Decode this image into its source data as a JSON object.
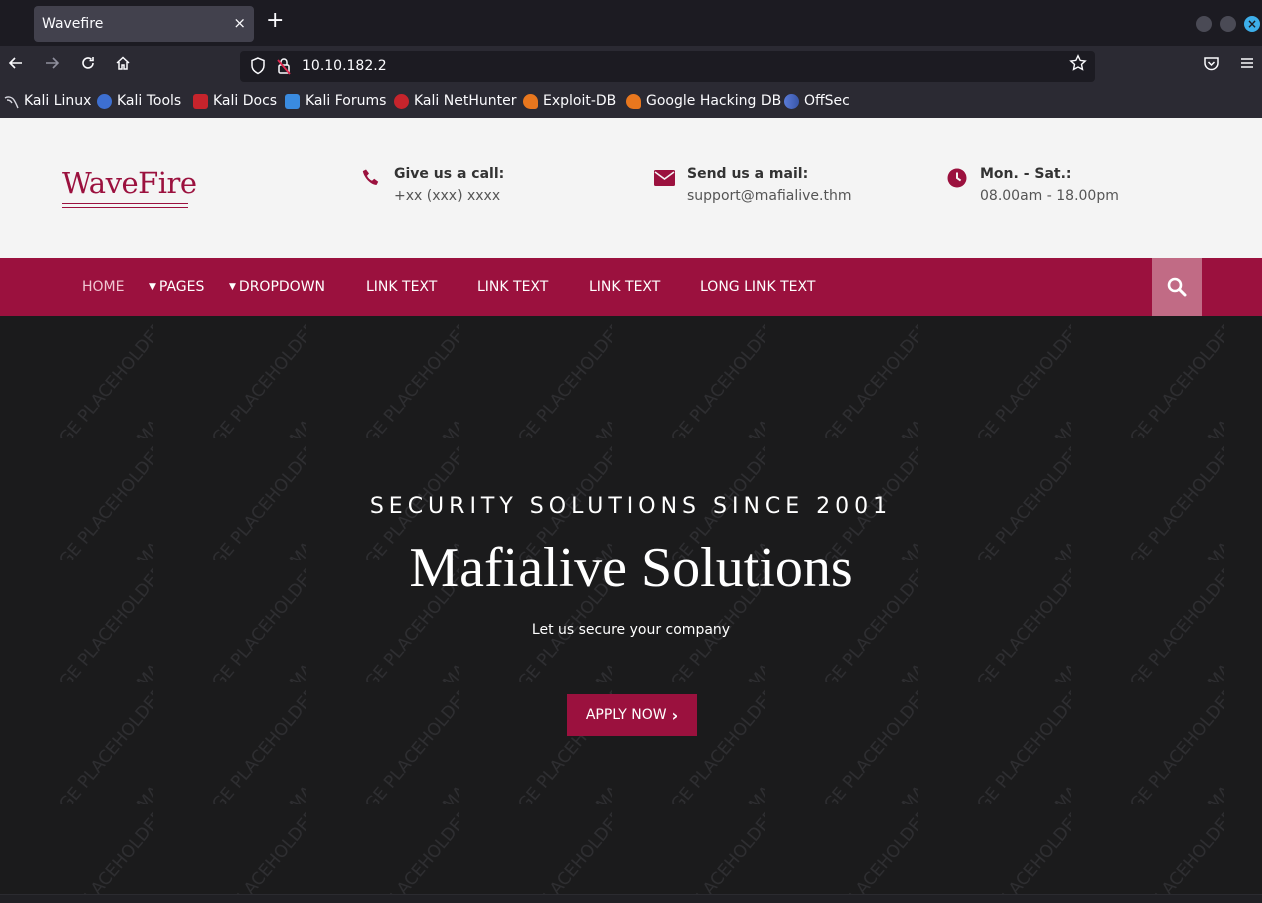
{
  "browser": {
    "tab_title": "Wavefire",
    "tab_close": "×",
    "new_tab": "+",
    "url": "10.10.182.2",
    "window_close": "×",
    "bookmarks": [
      "Kali Linux",
      "Kali Tools",
      "Kali Docs",
      "Kali Forums",
      "Kali NetHunter",
      "Exploit-DB",
      "Google Hacking DB",
      "OffSec"
    ]
  },
  "header": {
    "logo": "WaveFire",
    "contacts": [
      {
        "label": "Give us a call:",
        "value": "+xx (xxx) xxxx",
        "icon": "phone-icon"
      },
      {
        "label": "Send us a mail:",
        "value": "support@mafialive.thm",
        "icon": "envelope-icon"
      },
      {
        "label": "Mon. - Sat.:",
        "value": "08.00am - 18.00pm",
        "icon": "clock-icon"
      }
    ]
  },
  "menu": {
    "items": [
      "HOME",
      "PAGES",
      "DROPDOWN",
      "LINK TEXT",
      "LINK TEXT",
      "LINK TEXT",
      "LONG LINK TEXT"
    ]
  },
  "hero": {
    "watermark": "IMAGE PLACEHOLDER",
    "tagline": "SECURITY SOLUTIONS SINCE 2001",
    "title": "Mafialive Solutions",
    "subtitle": "Let us secure your company",
    "button": "APPLY NOW",
    "button_chevron": "›"
  },
  "colors": {
    "brand": "#9b113e",
    "header_bg": "#f4f4f4",
    "hero_bg": "#1b1b1c",
    "search_bg": "#c16b85"
  }
}
